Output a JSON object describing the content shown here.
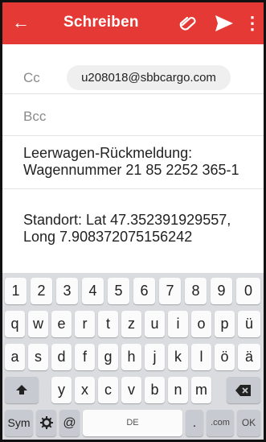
{
  "appbar": {
    "back_icon": "arrow-left-icon",
    "title": "Schreiben",
    "attach_icon": "paperclip-icon",
    "send_icon": "send-icon",
    "more_icon": "more-vert-icon",
    "color": "#e53935"
  },
  "fields": {
    "cc_label": "Cc",
    "cc_recipient": "u208018@sbbcargo.com",
    "bcc_label": "Bcc"
  },
  "subject": "Leerwagen-Rückmeldung: Wagennummer 21 85 2252 365-1",
  "body": "Standort: Lat 47.352391929557, Long 7.908372075156242",
  "keyboard": {
    "row1": [
      "1",
      "2",
      "3",
      "4",
      "5",
      "6",
      "7",
      "8",
      "9",
      "0"
    ],
    "row2": [
      "q",
      "w",
      "e",
      "r",
      "t",
      "z",
      "u",
      "i",
      "o",
      "p",
      "ü"
    ],
    "row3": [
      "a",
      "s",
      "d",
      "f",
      "g",
      "h",
      "j",
      "k",
      "l",
      "ö",
      "ä"
    ],
    "row4": [
      "y",
      "x",
      "c",
      "v",
      "b",
      "n",
      "m"
    ],
    "shift_icon": "shift-icon",
    "backspace_icon": "backspace-icon",
    "sym": "Sym",
    "settings_icon": "gear-icon",
    "at": "@",
    "space": "DE",
    "period": ".",
    "dotcom": ".com",
    "ok": "OK"
  }
}
